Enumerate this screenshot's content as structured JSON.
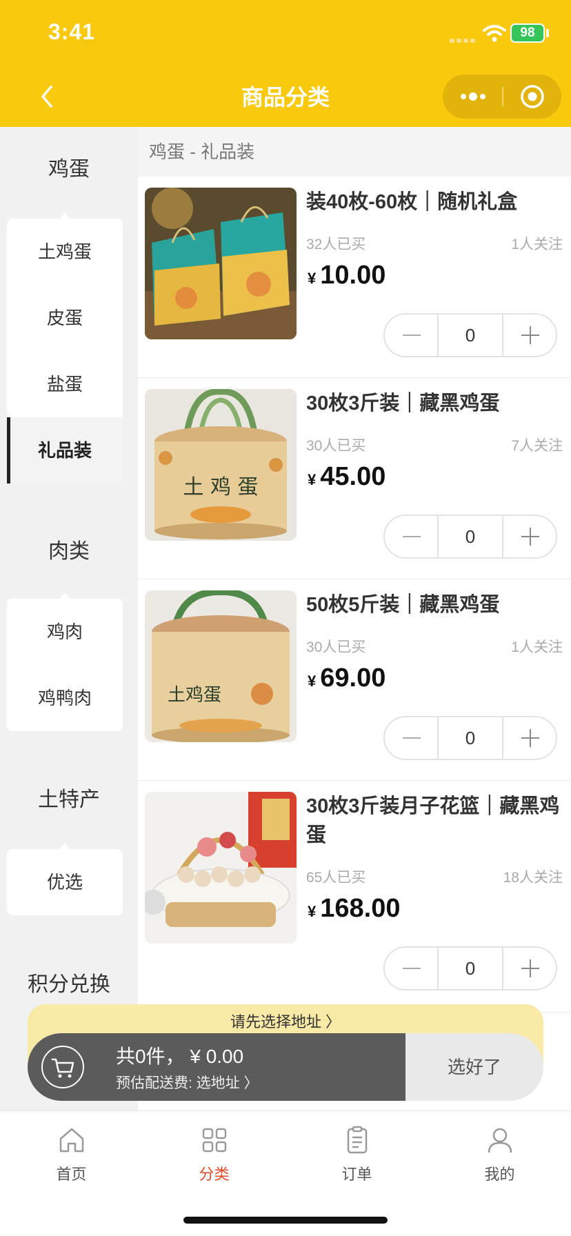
{
  "status_bar": {
    "time": "3:41",
    "battery": "98"
  },
  "header": {
    "title": "商品分类"
  },
  "sidebar": {
    "groups": [
      {
        "title": "鸡蛋",
        "items": [
          "土鸡蛋",
          "皮蛋",
          "盐蛋",
          "礼品装"
        ],
        "active_item": "礼品装"
      },
      {
        "title": "肉类",
        "items": [
          "鸡肉",
          "鸡鸭肉"
        ]
      },
      {
        "title": "土特产",
        "items": [
          "优选"
        ]
      },
      {
        "title": "积分兑换",
        "items": []
      }
    ]
  },
  "section": {
    "title": "鸡蛋 - 礼品装"
  },
  "products": [
    {
      "name": "装40枚-60枚｜随机礼盒",
      "sold": "32人已买",
      "follow": "1人关注",
      "currency": "¥",
      "price": "10.00",
      "qty": "0"
    },
    {
      "name": "30枚3斤装｜藏黑鸡蛋",
      "sold": "30人已买",
      "follow": "7人关注",
      "currency": "¥",
      "price": "45.00",
      "qty": "0"
    },
    {
      "name": "50枚5斤装｜藏黑鸡蛋",
      "sold": "30人已买",
      "follow": "1人关注",
      "currency": "¥",
      "price": "69.00",
      "qty": "0"
    },
    {
      "name": "30枚3斤装月子花篮｜藏黑鸡蛋",
      "sold": "65人已买",
      "follow": "18人关注",
      "currency": "¥",
      "price": "168.00",
      "qty": "0"
    }
  ],
  "cart": {
    "address_tip": "请先选择地址 〉",
    "summary": "共0件， ¥ 0.00",
    "fee": "预估配送费: 选地址 〉",
    "confirm": "选好了"
  },
  "tabbar": {
    "tabs": [
      {
        "label": "首页",
        "icon": "home-icon"
      },
      {
        "label": "分类",
        "icon": "category-icon"
      },
      {
        "label": "订单",
        "icon": "order-icon"
      },
      {
        "label": "我的",
        "icon": "user-icon"
      }
    ],
    "active": "分类"
  },
  "colors": {
    "brand": "#f8c90c",
    "active_tab": "#e04a2a",
    "cart_bar": "#5b5b5b"
  }
}
